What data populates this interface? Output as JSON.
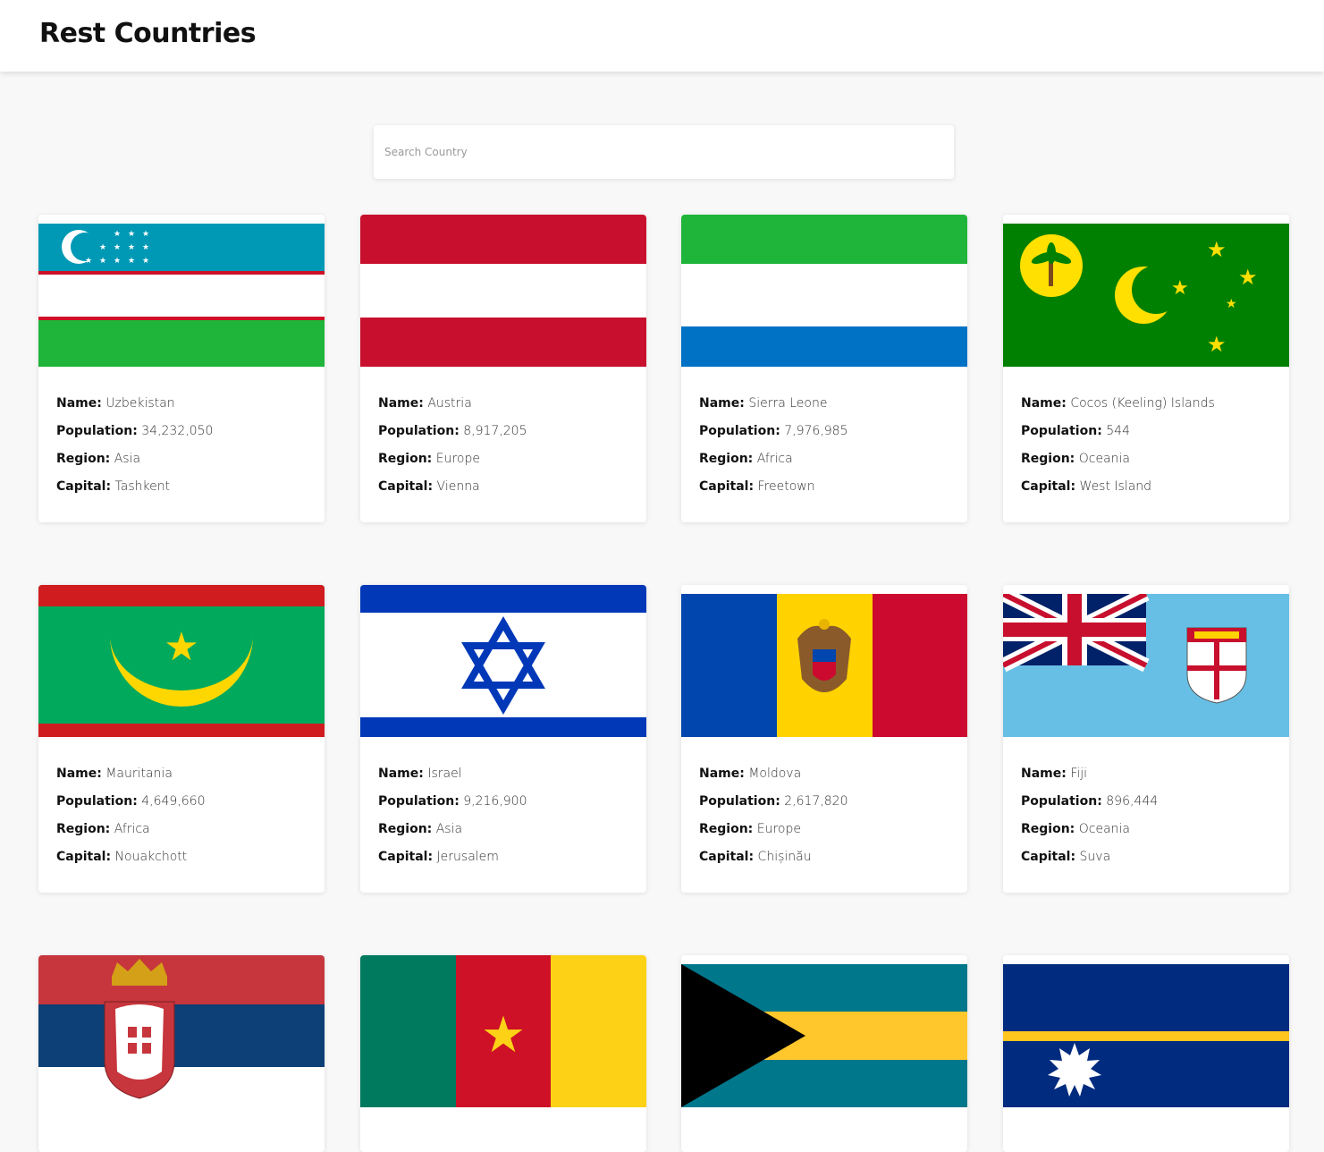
{
  "app": {
    "title": "Rest Countries"
  },
  "search": {
    "placeholder": "Search Country",
    "value": ""
  },
  "labels": {
    "name": "Name:",
    "population": "Population:",
    "region": "Region:",
    "capital": "Capital:"
  },
  "countries": [
    {
      "name": "Uzbekistan",
      "population": "34,232,050",
      "region": "Asia",
      "capital": "Tashkent",
      "flag_icon": "uzbekistan-flag",
      "colors": [
        "#0099b5",
        "#ce1126",
        "#ffffff",
        "#1eb53a"
      ]
    },
    {
      "name": "Austria",
      "population": "8,917,205",
      "region": "Europe",
      "capital": "Vienna",
      "flag_icon": "austria-flag",
      "colors": [
        "#c8102e",
        "#ffffff"
      ]
    },
    {
      "name": "Sierra Leone",
      "population": "7,976,985",
      "region": "Africa",
      "capital": "Freetown",
      "flag_icon": "sierra-leone-flag",
      "colors": [
        "#1eb53a",
        "#ffffff",
        "#0072c6"
      ]
    },
    {
      "name": "Cocos (Keeling) Islands",
      "population": "544",
      "region": "Oceania",
      "capital": "West Island",
      "flag_icon": "cocos-islands-flag",
      "colors": [
        "#008000",
        "#ffe000"
      ]
    },
    {
      "name": "Mauritania",
      "population": "4,649,660",
      "region": "Africa",
      "capital": "Nouakchott",
      "flag_icon": "mauritania-flag",
      "colors": [
        "#d01c1f",
        "#00a95c",
        "#ffd700"
      ]
    },
    {
      "name": "Israel",
      "population": "9,216,900",
      "region": "Asia",
      "capital": "Jerusalem",
      "flag_icon": "israel-flag",
      "colors": [
        "#0038b8",
        "#ffffff"
      ]
    },
    {
      "name": "Moldova",
      "population": "2,617,820",
      "region": "Europe",
      "capital": "Chișinău",
      "flag_icon": "moldova-flag",
      "colors": [
        "#0046ae",
        "#ffd200",
        "#cc092f"
      ]
    },
    {
      "name": "Fiji",
      "population": "896,444",
      "region": "Oceania",
      "capital": "Suva",
      "flag_icon": "fiji-flag",
      "colors": [
        "#68bfe5",
        "#012169",
        "#c8102e",
        "#ffffff"
      ]
    },
    {
      "name": "",
      "population": "",
      "region": "",
      "capital": "",
      "flag_icon": "serbia-flag",
      "colors": [
        "#c6363c",
        "#0c4076",
        "#ffffff"
      ]
    },
    {
      "name": "",
      "population": "",
      "region": "",
      "capital": "",
      "flag_icon": "cameroon-flag",
      "colors": [
        "#007a5e",
        "#ce1126",
        "#fcd116"
      ]
    },
    {
      "name": "",
      "population": "",
      "region": "",
      "capital": "",
      "flag_icon": "bahamas-flag",
      "colors": [
        "#00778b",
        "#ffc72c",
        "#000000"
      ]
    },
    {
      "name": "",
      "population": "",
      "region": "",
      "capital": "",
      "flag_icon": "nauru-flag",
      "colors": [
        "#002b7f",
        "#ffc61e",
        "#ffffff"
      ]
    }
  ]
}
